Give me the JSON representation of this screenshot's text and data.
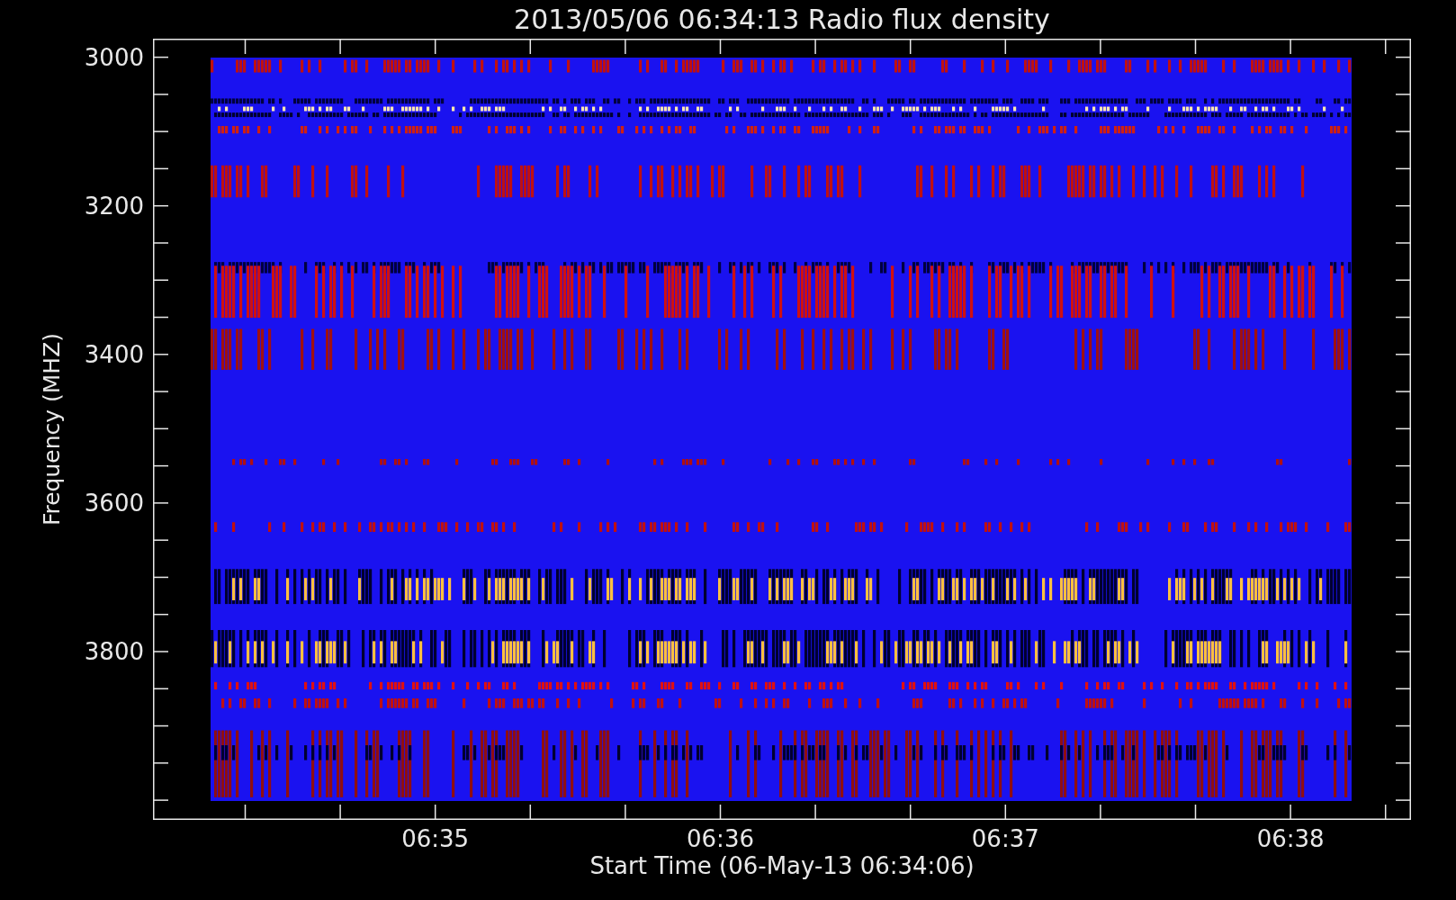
{
  "title": "2013/05/06 06:34:13 Radio flux density",
  "plot": {
    "ylabel": "Frequency (MHZ)",
    "xlabel": "Start Time (06-May-13 06:34:06)",
    "yticks": [
      {
        "label": "3000"
      },
      {
        "label": "3200"
      },
      {
        "label": "3400"
      },
      {
        "label": "3600"
      },
      {
        "label": "3800"
      }
    ],
    "xticks": [
      {
        "label": "06:35"
      },
      {
        "label": "06:36"
      },
      {
        "label": "06:37"
      },
      {
        "label": "06:38"
      }
    ]
  }
}
